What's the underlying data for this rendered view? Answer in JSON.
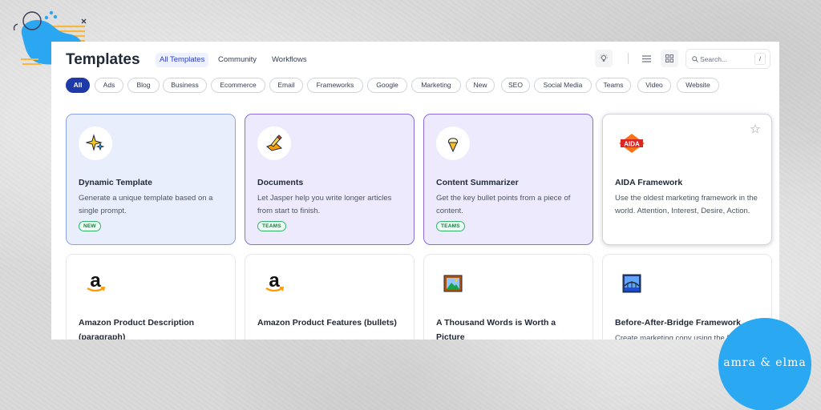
{
  "header": {
    "title": "Templates",
    "tabs": [
      "All Templates",
      "Community",
      "Workflows"
    ]
  },
  "search": {
    "placeholder": "Search...",
    "shortcut": "/"
  },
  "filters": [
    "All",
    "Ads",
    "Blog",
    "Business",
    "Ecommerce",
    "Email",
    "Frameworks",
    "Google",
    "Marketing",
    "New",
    "SEO",
    "Social Media",
    "Teams",
    "Video",
    "Website"
  ],
  "cards": [
    {
      "title": "Dynamic Template",
      "description": "Generate a unique template based on a single prompt.",
      "badge": "NEW",
      "icon": "sparkles-icon"
    },
    {
      "title": "Documents",
      "description": "Let Jasper help you write longer articles from start to finish.",
      "badge": "TEAMS",
      "icon": "pencil-doc-icon"
    },
    {
      "title": "Content Summarizer",
      "description": "Get the key bullet points from a piece of content.",
      "badge": "TEAMS",
      "icon": "ice-cream-icon"
    },
    {
      "title": "AIDA Framework",
      "description": "Use the oldest marketing framework in the world. Attention, Interest, Desire, Action.",
      "icon_text": "AIDA",
      "icon": "aida-logo-icon"
    },
    {
      "title": "Amazon Product Description (paragraph)",
      "icon": "amazon-logo-icon"
    },
    {
      "title": "Amazon Product Features (bullets)",
      "icon": "amazon-logo-icon"
    },
    {
      "title": "A Thousand Words is Worth a Picture",
      "icon": "picture-frame-icon"
    },
    {
      "title": "Before-After-Bridge Framework",
      "description": "Create marketing copy using the BAB",
      "icon": "bridge-picture-icon"
    }
  ],
  "watermark": {
    "text": "amra & elma"
  },
  "colors": {
    "primary": "#1e3aa8",
    "accent_purple": "#8b6cdc",
    "badge_green": "#34b36a",
    "logo_blue": "#2aa8f2"
  }
}
